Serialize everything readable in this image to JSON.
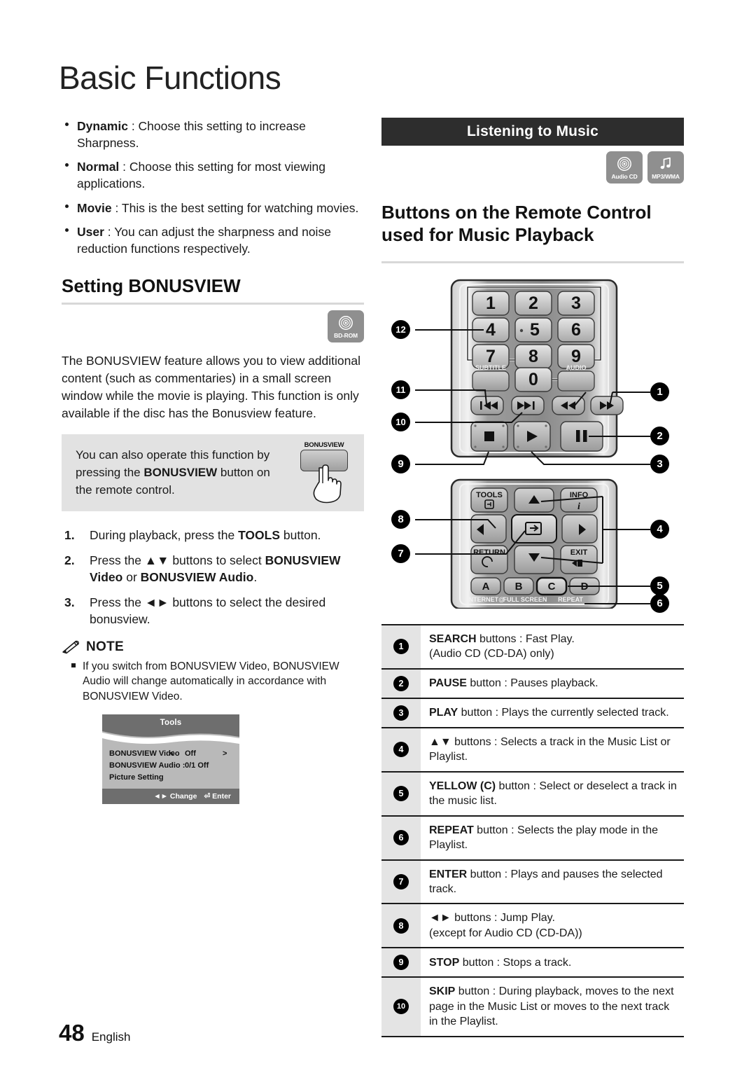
{
  "chapter": {
    "title": "Basic Functions"
  },
  "left": {
    "bullets": [
      {
        "term": "Dynamic",
        "sep": " : ",
        "text": "Choose this setting to increase Sharpness."
      },
      {
        "term": "Normal",
        "sep": " : ",
        "text": "Choose this setting for most viewing applications."
      },
      {
        "term": "Movie",
        "sep": " : ",
        "text": "This is the best setting for watching movies."
      },
      {
        "term": "User",
        "sep": " : ",
        "text": "You can adjust the sharpness and noise reduction functions respectively."
      }
    ],
    "section_heading": "Setting BONUSVIEW",
    "disc_badge": {
      "label": "BD-ROM",
      "icon": "bd-rom-disc-icon"
    },
    "paragraph": "The BONUSVIEW feature allows you to view additional content (such as commentaries) in a small screen window while the movie is playing. This function is only available if the disc has the Bonusview feature.",
    "tip": {
      "line1": "You can also operate this function by",
      "bold": "BONUSVIEW",
      "line2_pre": "pressing the ",
      "line2_post": " button on",
      "line3": "the remote control.",
      "remote_button_label": "BONUSVIEW"
    },
    "steps": [
      {
        "num": "1.",
        "parts": [
          {
            "t": "During playback, press the ",
            "b": false
          },
          {
            "t": "TOOLS",
            "b": true
          },
          {
            "t": " button.",
            "b": false
          }
        ]
      },
      {
        "num": "2.",
        "parts": [
          {
            "t": "Press the ",
            "b": false
          },
          {
            "t": "▲▼",
            "b": false
          },
          {
            "t": " buttons to select ",
            "b": false
          },
          {
            "t": "BONUSVIEW Video",
            "b": true
          },
          {
            "t": " or ",
            "b": false
          },
          {
            "t": "BONUSVIEW Audio",
            "b": true
          },
          {
            "t": ".",
            "b": false
          }
        ]
      },
      {
        "num": "3.",
        "parts": [
          {
            "t": "Press the ",
            "b": false
          },
          {
            "t": "◄►",
            "b": false
          },
          {
            "t": " buttons to select the desired bonusview.",
            "b": false
          }
        ]
      }
    ],
    "note": {
      "heading": "NOTE",
      "icon": "pencil-note-icon",
      "items": [
        "If you switch from BONUSVIEW Video, BONUSVIEW Audio will change automatically in accordance with BONUSVIEW Video."
      ]
    },
    "osd": {
      "title": "Tools",
      "rows": [
        {
          "label": "BONUSVIEW Video",
          "lt": "<",
          "value": "Off",
          "gt": ">"
        },
        {
          "label": "BONUSVIEW Audio :",
          "lt": "",
          "value": "0/1 Off",
          "gt": ""
        },
        {
          "label": "Picture Setting",
          "lt": "",
          "value": "",
          "gt": ""
        }
      ],
      "footer": {
        "change": "Change",
        "enter": "Enter",
        "change_arrows": "◄►",
        "enter_icon": "enter-key-icon"
      }
    }
  },
  "right": {
    "banner": "Listening to Music",
    "badges": [
      {
        "label": "Audio CD",
        "icon": "audio-cd-disc-icon"
      },
      {
        "label": "MP3/WMA",
        "icon": "music-note-icon"
      }
    ],
    "heading_line1": "Buttons on the Remote Control",
    "heading_line2": "used for Music Playback",
    "remote": {
      "keypad": [
        "1",
        "2",
        "3",
        "4",
        "5",
        "6",
        "7",
        "8",
        "9",
        "0"
      ],
      "top_labels": {
        "subtitle": "SUBTITLE",
        "audio": "AUDIO"
      },
      "transport": {
        "skip_back": "⏮",
        "skip_fwd": "⏭",
        "rew": "◄◄",
        "ff": "►►",
        "stop": "■",
        "play": "►",
        "pause": "❚❚"
      },
      "nav_labels": {
        "tools": "TOOLS",
        "info": "INFO",
        "return": "RETURN",
        "exit": "EXIT"
      },
      "color_keys": [
        "A",
        "B",
        "C",
        "D"
      ],
      "color_key_labels": {
        "a": "INTERNET@",
        "b": "FULL SCREEN",
        "c": "REPEAT"
      },
      "callouts_left": [
        "12",
        "11",
        "10",
        "9",
        "8",
        "7"
      ],
      "callouts_right": [
        "1",
        "2",
        "3",
        "4",
        "5",
        "6"
      ]
    },
    "legend": [
      {
        "n": "1",
        "parts": [
          {
            "t": "SEARCH",
            "b": true
          },
          {
            "t": " buttons : Fast Play.",
            "b": false
          },
          {
            "br": true
          },
          {
            "t": "(Audio CD (CD-DA) only)",
            "b": false
          }
        ]
      },
      {
        "n": "2",
        "parts": [
          {
            "t": "PAUSE",
            "b": true
          },
          {
            "t": " button : Pauses playback.",
            "b": false
          }
        ]
      },
      {
        "n": "3",
        "parts": [
          {
            "t": "PLAY",
            "b": true
          },
          {
            "t": " button : Plays the currently selected track.",
            "b": false
          }
        ]
      },
      {
        "n": "4",
        "parts": [
          {
            "t": "▲▼",
            "b": false
          },
          {
            "t": " buttons : Selects a track in the Music List or Playlist.",
            "b": false
          }
        ]
      },
      {
        "n": "5",
        "parts": [
          {
            "t": "YELLOW (C)",
            "b": true
          },
          {
            "t": " button : Select or deselect a track in the music list.",
            "b": false
          }
        ]
      },
      {
        "n": "6",
        "parts": [
          {
            "t": "REPEAT",
            "b": true
          },
          {
            "t": " button : Selects the play mode in the Playlist.",
            "b": false
          }
        ]
      },
      {
        "n": "7",
        "parts": [
          {
            "t": "ENTER",
            "b": true
          },
          {
            "t": " button : Plays and pauses the selected track.",
            "b": false
          }
        ]
      },
      {
        "n": "8",
        "parts": [
          {
            "t": "◄►",
            "b": false
          },
          {
            "t": " buttons : Jump Play.",
            "b": false
          },
          {
            "br": true
          },
          {
            "t": "(except for Audio CD (CD-DA))",
            "b": false
          }
        ]
      },
      {
        "n": "9",
        "parts": [
          {
            "t": "STOP",
            "b": true
          },
          {
            "t": " button : Stops a track.",
            "b": false
          }
        ]
      },
      {
        "n": "10",
        "parts": [
          {
            "t": "SKIP",
            "b": true
          },
          {
            "t": " button : During playback, moves to the next page in the Music List or moves to the next track in the Playlist.",
            "b": false
          }
        ]
      }
    ]
  },
  "footer": {
    "page_number": "48",
    "language": "English"
  },
  "colors": {
    "banner_bg": "#2d2d2d",
    "badge_gray": "#8f8f8f",
    "tip_gray": "#e2e2e2",
    "legend_num_bg": "#e4e4e4",
    "rule_gray": "#d8d8d8"
  }
}
